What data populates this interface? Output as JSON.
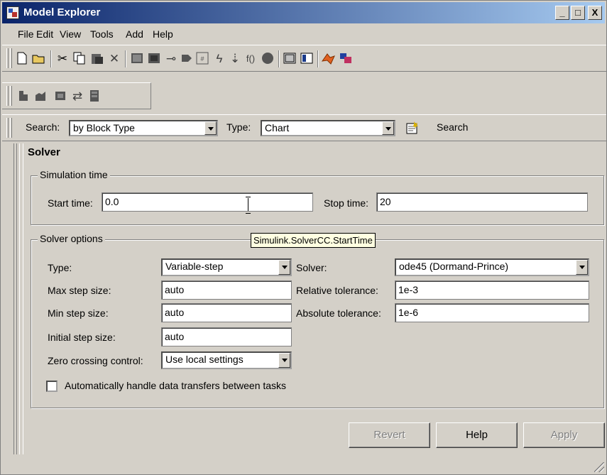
{
  "window": {
    "title": "Model Explorer",
    "title_icon": "model-explorer-icon",
    "controls": [
      "_",
      "□",
      "X"
    ]
  },
  "menu": [
    "File",
    "Edit",
    "View",
    "Tools",
    "Add",
    "Help"
  ],
  "search": {
    "label": "Search:",
    "by_value": "by Block Type",
    "type_label": "Type:",
    "type_value": "Chart",
    "button_label": "Search"
  },
  "panel": {
    "heading": "Solver",
    "simulation_time": {
      "title": "Simulation time",
      "start_label": "Start time:",
      "start_value": "0.0",
      "stop_label": "Stop time:",
      "stop_value": "20"
    },
    "solver_options": {
      "title": "Solver options",
      "type_label": "Type:",
      "type_value": "Variable-step",
      "solver_label": "Solver:",
      "solver_value": "ode45 (Dormand-Prince)",
      "max_step_label": "Max step size:",
      "max_step_value": "auto",
      "rel_tol_label": "Relative tolerance:",
      "rel_tol_value": "1e-3",
      "min_step_label": "Min step size:",
      "min_step_value": "auto",
      "abs_tol_label": "Absolute tolerance:",
      "abs_tol_value": "1e-6",
      "initial_step_label": "Initial step size:",
      "initial_step_value": "auto",
      "zero_crossing_label": "Zero crossing control:",
      "zero_crossing_value": "Use local settings",
      "auto_handle_label": "Automatically handle data transfers between tasks",
      "auto_handle_checked": false
    },
    "tooltip": "Simulink.SolverCC.StartTime"
  },
  "buttons": {
    "revert": "Revert",
    "help": "Help",
    "apply": "Apply"
  }
}
